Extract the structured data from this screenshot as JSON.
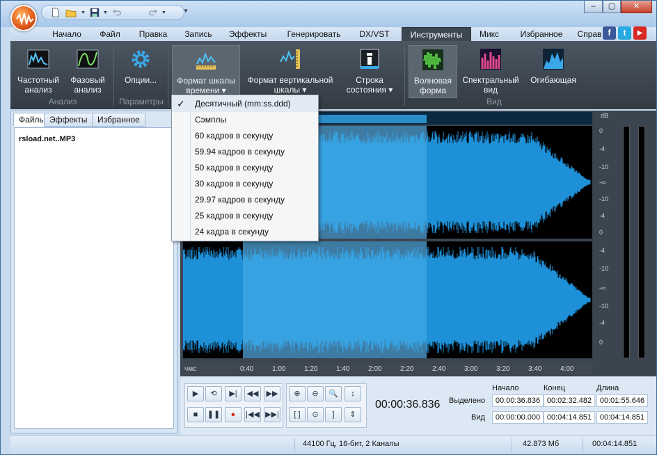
{
  "menu": {
    "tabs": [
      "Начало",
      "Файл",
      "Правка",
      "Запись",
      "Эффекты",
      "Генерировать",
      "DX/VST",
      "Инструменты",
      "Микс",
      "Избранное",
      "Справ"
    ],
    "active": "Инструменты"
  },
  "social": {
    "facebook": "f",
    "twitter": "t",
    "youtube": "▶"
  },
  "window_controls": {
    "minimize": "–",
    "restore": "▢",
    "close": "✕"
  },
  "ribbon": {
    "items": [
      {
        "id": "freq",
        "label1": "Частотный",
        "label2": "анализ"
      },
      {
        "id": "phase",
        "label1": "Фазовый",
        "label2": "анализ"
      },
      {
        "id": "options",
        "label1": "Опции...",
        "label2": ""
      },
      {
        "id": "timeformat",
        "label1": "Формат шкалы",
        "label2": "времени ▾"
      },
      {
        "id": "vformat",
        "label1": "Формат вертикальной",
        "label2": "шкалы ▾"
      },
      {
        "id": "statusbar",
        "label1": "Строка",
        "label2": "состояния ▾"
      },
      {
        "id": "waveform",
        "label1": "Волновая",
        "label2": "форма"
      },
      {
        "id": "spectral",
        "label1": "Спектральный",
        "label2": "вид"
      },
      {
        "id": "envelope",
        "label1": "Огибающая",
        "label2": ""
      }
    ],
    "groups": {
      "analysis": "Анализ",
      "params": "Параметры",
      "view": "Вид"
    }
  },
  "dropdown": {
    "items": [
      "Десятичный (mm:ss.ddd)",
      "Сэмплы",
      "60 кадров в секунду",
      "59.94 кадров в секунду",
      "50 кадров в секунду",
      "30 кадров в секунду",
      "29.97 кадров в секунду",
      "25 кадров в секунду",
      "24 кадра в секунду"
    ],
    "check_mark": "✓"
  },
  "left_panel": {
    "tabs": [
      "Файлы",
      "Эффекты",
      "Избранное"
    ],
    "files": [
      "rsload.net..MP3"
    ]
  },
  "db_scale": {
    "unit": "dB",
    "top_track": [
      "0",
      "-4",
      "-10",
      "-∞",
      "-10",
      "-4",
      "0"
    ],
    "bottom_track": [
      "-4",
      "-10",
      "-∞",
      "-10",
      "-4",
      "0"
    ]
  },
  "timeline": {
    "unit": "чмс",
    "ticks": [
      "0:40",
      "1:00",
      "1:20",
      "1:40",
      "2:00",
      "2:20",
      "2:40",
      "3:00",
      "3:20",
      "3:40",
      "4:00"
    ]
  },
  "transport": {
    "current_time": "00:00:36.836"
  },
  "selection_info": {
    "headers": {
      "start": "Начало",
      "end": "Конец",
      "length": "Длина"
    },
    "rows": {
      "selection": {
        "label": "Выделено",
        "start": "00:00:36.836",
        "end": "00:02:32.482",
        "length": "00:01:55.646"
      },
      "view": {
        "label": "Вид",
        "start": "00:00:00.000",
        "end": "00:04:14.851",
        "length": "00:04:14.851"
      }
    }
  },
  "status": {
    "format": "44100 Гц, 16-бит, 2 Каналы",
    "size": "42.873 Мб",
    "duration": "00:04:14.851"
  },
  "colors": {
    "ribbon_bg": "#3d4752",
    "wave_color": "#1e90d8",
    "selection_color": "#56b7ee",
    "window_frame": "#c9dcef"
  }
}
